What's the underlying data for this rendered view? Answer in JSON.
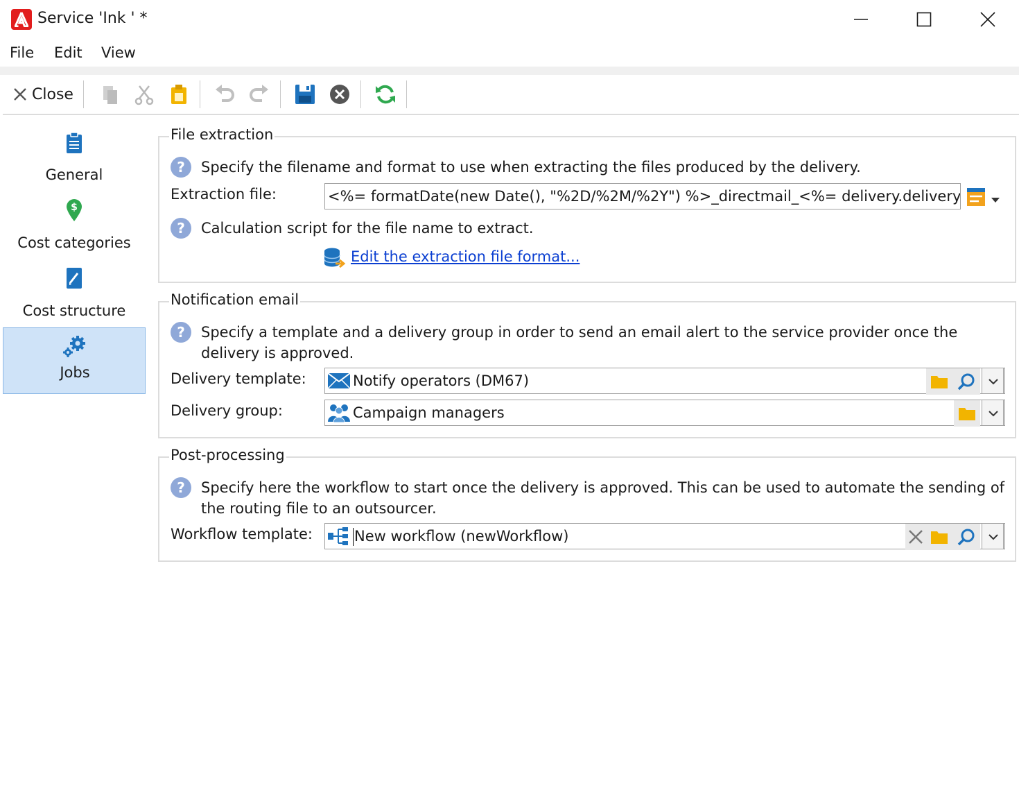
{
  "window": {
    "title": "Service 'Ink ' *"
  },
  "menu": {
    "items": [
      "File",
      "Edit",
      "View"
    ]
  },
  "toolbar": {
    "close_label": "Close"
  },
  "nav": {
    "items": [
      {
        "label": "General",
        "icon": "clipboard-icon"
      },
      {
        "label": "Cost categories",
        "icon": "money-pin-icon"
      },
      {
        "label": "Cost structure",
        "icon": "edit-document-icon"
      },
      {
        "label": "Jobs",
        "icon": "gears-icon",
        "active": true
      }
    ]
  },
  "file_extraction": {
    "title": "File extraction",
    "help": "Specify the filename and format to use when extracting the files produced by the delivery.",
    "extraction_label": "Extraction file:",
    "extraction_value": "<%= formatDate(new Date(), \"%2D/%2M/%2Y\") %>_directmail_<%= delivery.deliveryCode %>",
    "calc_help": "Calculation script for the file name to extract.",
    "edit_link": "Edit the extraction file format..."
  },
  "notification": {
    "title": "Notification email",
    "help_line1": "Specify a template and a delivery group in order to send an email alert to the service provider once the",
    "help_line2": "delivery is approved.",
    "template_label": "Delivery template:",
    "template_value": "Notify operators (DM67)",
    "group_label": "Delivery group:",
    "group_value": "Campaign managers"
  },
  "post_processing": {
    "title": "Post-processing",
    "help_line1": "Specify here the workflow to start once the delivery is approved. This can be used to automate the sending of",
    "help_line2": "the routing file to an outsourcer.",
    "workflow_label": "Workflow template:",
    "workflow_value": "New workflow (newWorkflow)"
  },
  "colors": {
    "accent": "#1e73be",
    "active_nav": "#cfe3f8",
    "link": "#0b3fd1",
    "help": "#8fa8d8"
  }
}
